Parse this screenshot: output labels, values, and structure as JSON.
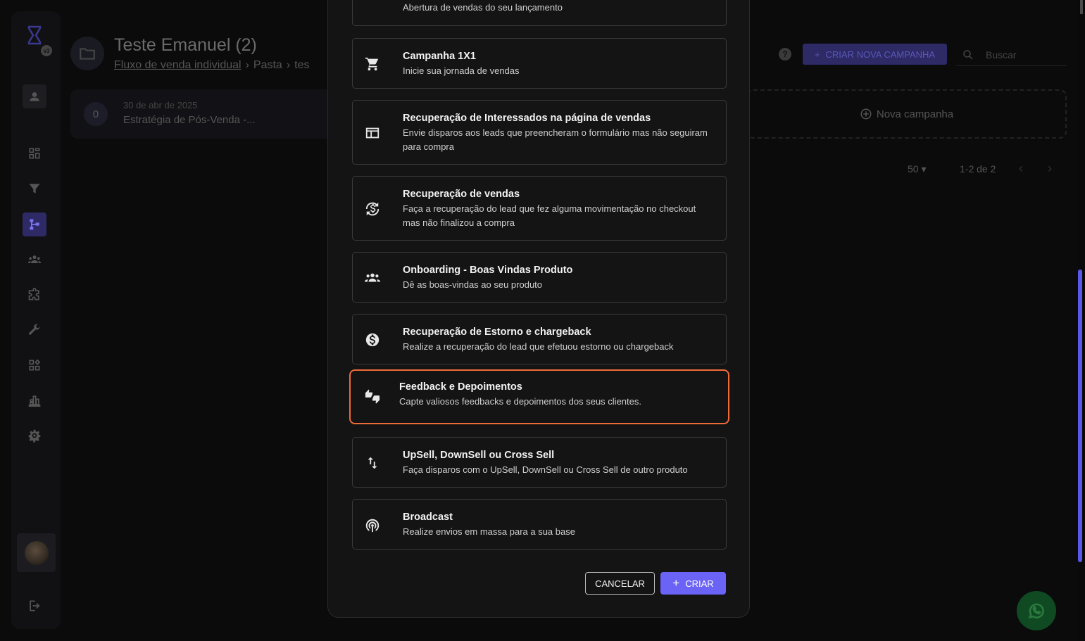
{
  "header": {
    "title": "Teste Emanuel (2)",
    "breadcrumb": [
      "Fluxo de venda individual",
      "Pasta",
      "tes"
    ],
    "breadcrumb_sep": "›",
    "new_campaign_label": "CRIAR NOVA CAMPANHA",
    "search_placeholder": "Buscar"
  },
  "logo_badge": "v3",
  "campaign": {
    "index": "0",
    "date": "30 de abr de 2025",
    "name": "Estratégia de Pós-Venda -..."
  },
  "new_slot_label": "Nova campanha",
  "pagination": {
    "per_page": "50",
    "range": "1-2 de 2"
  },
  "modal": {
    "options": [
      {
        "title": "",
        "desc": "Abertura de vendas do seu lançamento",
        "icon": "launch-icon"
      },
      {
        "title": "Campanha 1X1",
        "desc": "Inicie sua jornada de vendas",
        "icon": "cart-icon"
      },
      {
        "title": "Recuperação de Interessados na página de vendas",
        "desc": "Envie disparos aos leads que preencheram o formulário mas não seguiram para compra",
        "icon": "webpage-icon"
      },
      {
        "title": "Recuperação de vendas",
        "desc": "Faça a recuperação do lead que fez alguma movimentação no checkout mas não finalizou a compra",
        "icon": "currency-exchange-icon"
      },
      {
        "title": "Onboarding - Boas Vindas Produto",
        "desc": "Dê as boas-vindas ao seu produto",
        "icon": "group-icon"
      },
      {
        "title": "Recuperação de Estorno e chargeback",
        "desc": "Realize a recuperação do lead que efetuou estorno ou chargeback",
        "icon": "dollar-circle-icon"
      },
      {
        "title": "Feedback e Depoimentos",
        "desc": "Capte valiosos feedbacks e depoimentos dos seus clientes.",
        "icon": "thumbs-up-down-icon"
      },
      {
        "title": "UpSell, DownSell ou Cross Sell",
        "desc": "Faça disparos com o UpSell, DownSell ou Cross Sell de outro produto",
        "icon": "swap-vertical-icon"
      },
      {
        "title": "Broadcast",
        "desc": "Realize envios em massa para a sua base",
        "icon": "podcast-icon"
      }
    ],
    "selected_index": 6,
    "cancel_label": "CANCELAR",
    "create_label": "CRIAR",
    "selected_border_color": "#ef6a3a",
    "accent_color": "#6a63f6"
  }
}
